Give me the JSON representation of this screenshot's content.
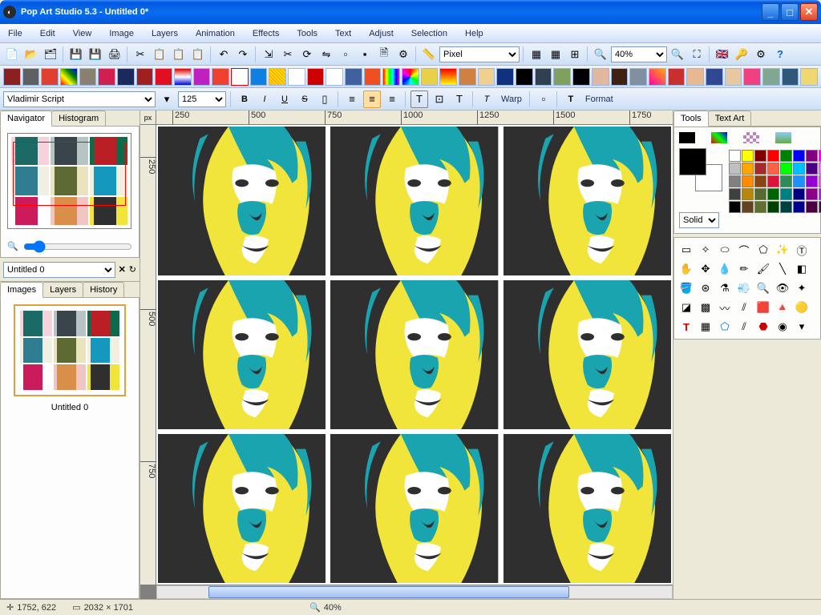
{
  "window": {
    "title": "Pop Art Studio 5.3 - Untitled 0*"
  },
  "menu": [
    "File",
    "Edit",
    "View",
    "Image",
    "Layers",
    "Animation",
    "Effects",
    "Tools",
    "Text",
    "Adjust",
    "Selection",
    "Help"
  ],
  "toolbar1": {
    "unit_select": "Pixel",
    "zoom_value": "40%"
  },
  "fontbar": {
    "font_name": "Vladimir Script",
    "font_size": "125",
    "warp_label": "Warp",
    "format_label": "Format"
  },
  "left": {
    "tabs_nav": [
      "Navigator",
      "Histogram"
    ],
    "doc_select": "Untitled 0",
    "tabs_img": [
      "Images",
      "Layers",
      "History"
    ],
    "thumb_caption": "Untitled 0"
  },
  "ruler_corner": "px",
  "ruler_h": [
    "250",
    "500",
    "750",
    "1000",
    "1250",
    "1500",
    "1750"
  ],
  "ruler_v": [
    "250",
    "500",
    "750"
  ],
  "right": {
    "tabs": [
      "Tools",
      "Text Art"
    ],
    "fill_mode": "Solid",
    "palette": [
      "#ffffff",
      "#ffff00",
      "#800000",
      "#ff0000",
      "#008000",
      "#0000ff",
      "#800080",
      "#ff00ff",
      "#c0c0c0",
      "#ffa500",
      "#a52a2a",
      "#ff6347",
      "#00ff00",
      "#00bfff",
      "#4b0082",
      "#ee82ee",
      "#808080",
      "#ff8c00",
      "#8b4513",
      "#dc143c",
      "#2e8b57",
      "#1e90ff",
      "#9400d3",
      "#da70d6",
      "#404040",
      "#b8860b",
      "#556b2f",
      "#006400",
      "#008080",
      "#000080",
      "#8b008b",
      "#9932cc",
      "#000000",
      "#654321",
      "#607030",
      "#004000",
      "#004040",
      "#00008b",
      "#4b0040",
      "#301934"
    ]
  },
  "status": {
    "coords": "1752, 622",
    "dims": "2032 × 1701",
    "zoom": "40%"
  },
  "popart_colors": [
    {
      "bg": "#f6d3da",
      "shadow": "#1c6a66",
      "mid": "#e7d949",
      "light": "#ffffff"
    },
    {
      "bg": "#b8c3c6",
      "shadow": "#3a444b",
      "mid": "#7f8c92",
      "light": "#e0e5e7"
    },
    {
      "bg": "#0f6a4b",
      "shadow": "#b91f25",
      "mid": "#e8d63a",
      "light": "#f5efc1"
    },
    {
      "bg": "#f1eee2",
      "shadow": "#2e7d91",
      "mid": "#4a98aa",
      "light": "#d5e8ec"
    },
    {
      "bg": "#e9e3be",
      "shadow": "#5e6a34",
      "mid": "#cf8b3f",
      "light": "#f2e9cf"
    },
    {
      "bg": "#f1eee2",
      "shadow": "#1598be",
      "mid": "#1aa8cc",
      "light": "#ffffff"
    },
    {
      "bg": "#ffffff",
      "shadow": "#cc1b5b",
      "mid": "#35b7c2",
      "light": "#f6e3bd"
    },
    {
      "bg": "#f1c6c2",
      "shadow": "#d98f49",
      "mid": "#f1d93e",
      "light": "#faf0e0"
    },
    {
      "bg": "#f1e43a",
      "shadow": "#2f2f2f",
      "mid": "#1aa4b0",
      "light": "#ffffff"
    }
  ]
}
